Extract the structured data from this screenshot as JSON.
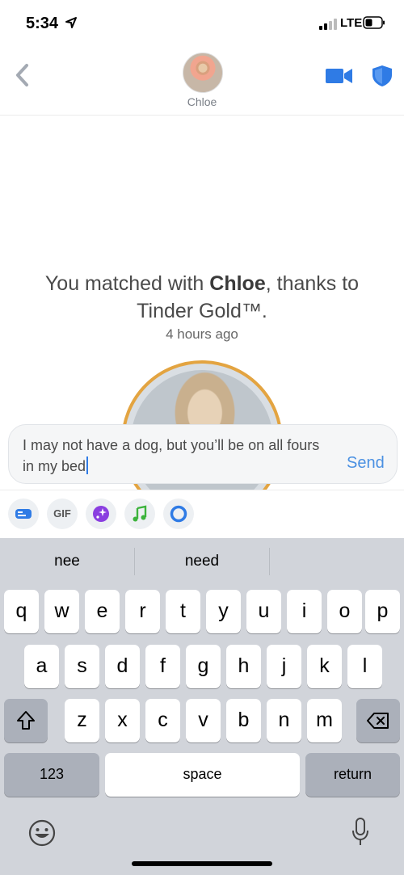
{
  "status": {
    "time": "5:34",
    "network": "LTE"
  },
  "header": {
    "name": "Chloe"
  },
  "match": {
    "prefix": "You matched with ",
    "name": "Chloe",
    "suffix": ", thanks to Tinder Gold™.",
    "time": "4 hours ago"
  },
  "composer": {
    "text": "I may not have a dog, but you’ll be on all fours in my bed",
    "send_label": "Send"
  },
  "tools": [
    {
      "icon": "sticker-card-icon"
    },
    {
      "icon": "gif-icon",
      "label": "GIF"
    },
    {
      "icon": "sparkle-icon"
    },
    {
      "icon": "music-note-icon"
    },
    {
      "icon": "ring-icon"
    }
  ],
  "keyboard": {
    "suggestions": [
      "nee",
      "need",
      ""
    ],
    "row1": [
      "q",
      "w",
      "e",
      "r",
      "t",
      "y",
      "u",
      "i",
      "o",
      "p"
    ],
    "row2": [
      "a",
      "s",
      "d",
      "f",
      "g",
      "h",
      "j",
      "k",
      "l"
    ],
    "row3": [
      "z",
      "x",
      "c",
      "v",
      "b",
      "n",
      "m"
    ],
    "numbers_label": "123",
    "space_label": "space",
    "return_label": "return"
  },
  "colors": {
    "accent": "#4a90e2",
    "gold": "#e3a441",
    "icon_blue": "#2f7be5"
  }
}
